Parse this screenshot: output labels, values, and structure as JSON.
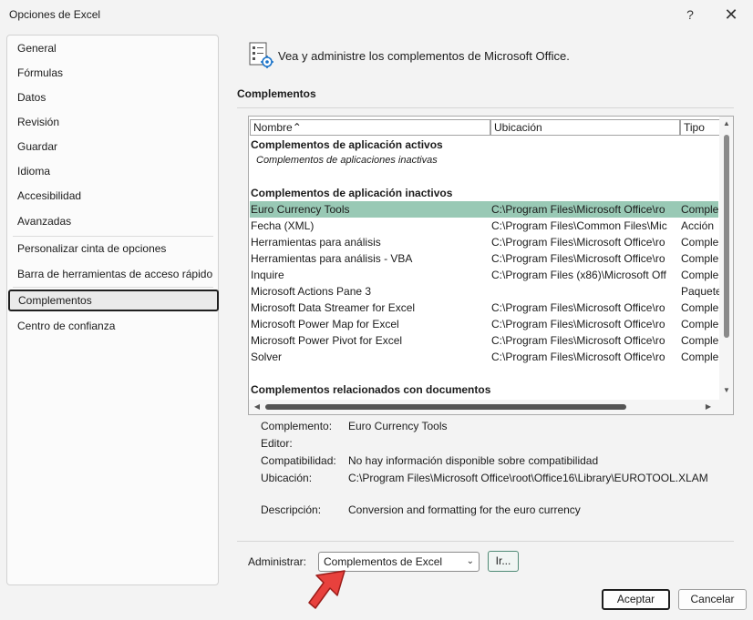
{
  "window": {
    "title": "Opciones de Excel",
    "help_glyph": "?",
    "close_glyph": "✕"
  },
  "sidebar": {
    "items": [
      {
        "label": "General"
      },
      {
        "label": "Fórmulas"
      },
      {
        "label": "Datos"
      },
      {
        "label": "Revisión"
      },
      {
        "label": "Guardar"
      },
      {
        "label": "Idioma"
      },
      {
        "label": "Accesibilidad"
      },
      {
        "label": "Avanzadas"
      },
      {
        "label": "Personalizar cinta de opciones"
      },
      {
        "label": "Barra de herramientas de acceso rápido"
      },
      {
        "label": "Complementos"
      },
      {
        "label": "Centro de confianza"
      }
    ],
    "selected": "Complementos"
  },
  "header": {
    "text": "Vea y administre los complementos de Microsoft Office.",
    "icon": "addins-settings-icon"
  },
  "section": {
    "title": "Complementos"
  },
  "table": {
    "columns": [
      "Nombre",
      "Ubicación",
      "Tipo"
    ],
    "sort_glyph": "⌃",
    "active_group": "Complementos de aplicación activos",
    "active_empty": "Complementos de aplicaciones inactivas",
    "inactive_group": "Complementos de aplicación inactivos",
    "rows": [
      {
        "name": "Euro Currency Tools",
        "location": "C:\\Program Files\\Microsoft Office\\ro",
        "type": "Comple",
        "selected": true
      },
      {
        "name": "Fecha (XML)",
        "location": "C:\\Program Files\\Common Files\\Mic",
        "type": "Acción"
      },
      {
        "name": "Herramientas para análisis",
        "location": "C:\\Program Files\\Microsoft Office\\ro",
        "type": "Comple"
      },
      {
        "name": "Herramientas para análisis - VBA",
        "location": "C:\\Program Files\\Microsoft Office\\ro",
        "type": "Comple"
      },
      {
        "name": "Inquire",
        "location": "C:\\Program Files (x86)\\Microsoft Off",
        "type": "Comple"
      },
      {
        "name": "Microsoft Actions Pane 3",
        "location": "",
        "type": "Paquete"
      },
      {
        "name": "Microsoft Data Streamer for Excel",
        "location": "C:\\Program Files\\Microsoft Office\\ro",
        "type": "Comple"
      },
      {
        "name": "Microsoft Power Map for Excel",
        "location": "C:\\Program Files\\Microsoft Office\\ro",
        "type": "Comple"
      },
      {
        "name": "Microsoft Power Pivot for Excel",
        "location": "C:\\Program Files\\Microsoft Office\\ro",
        "type": "Comple"
      },
      {
        "name": "Solver",
        "location": "C:\\Program Files\\Microsoft Office\\ro",
        "type": "Comple"
      }
    ],
    "document_group": "Complementos relacionados con documentos"
  },
  "details": {
    "complemento_label": "Complemento:",
    "complemento_value": "Euro Currency Tools",
    "editor_label": "Editor:",
    "editor_value": "",
    "compat_label": "Compatibilidad:",
    "compat_value": "No hay información disponible sobre compatibilidad",
    "location_label": "Ubicación:",
    "location_value": "C:\\Program Files\\Microsoft Office\\root\\Office16\\Library\\EUROTOOL.XLAM",
    "description_label": "Descripción:",
    "description_value": "Conversion and formatting for the euro currency"
  },
  "manage": {
    "label": "Administrar:",
    "selected": "Complementos de Excel",
    "go_label": "Ir..."
  },
  "buttons": {
    "ok": "Aceptar",
    "cancel": "Cancelar"
  },
  "colors": {
    "selection": "#99c9b5",
    "arrow": "#e8413d"
  }
}
